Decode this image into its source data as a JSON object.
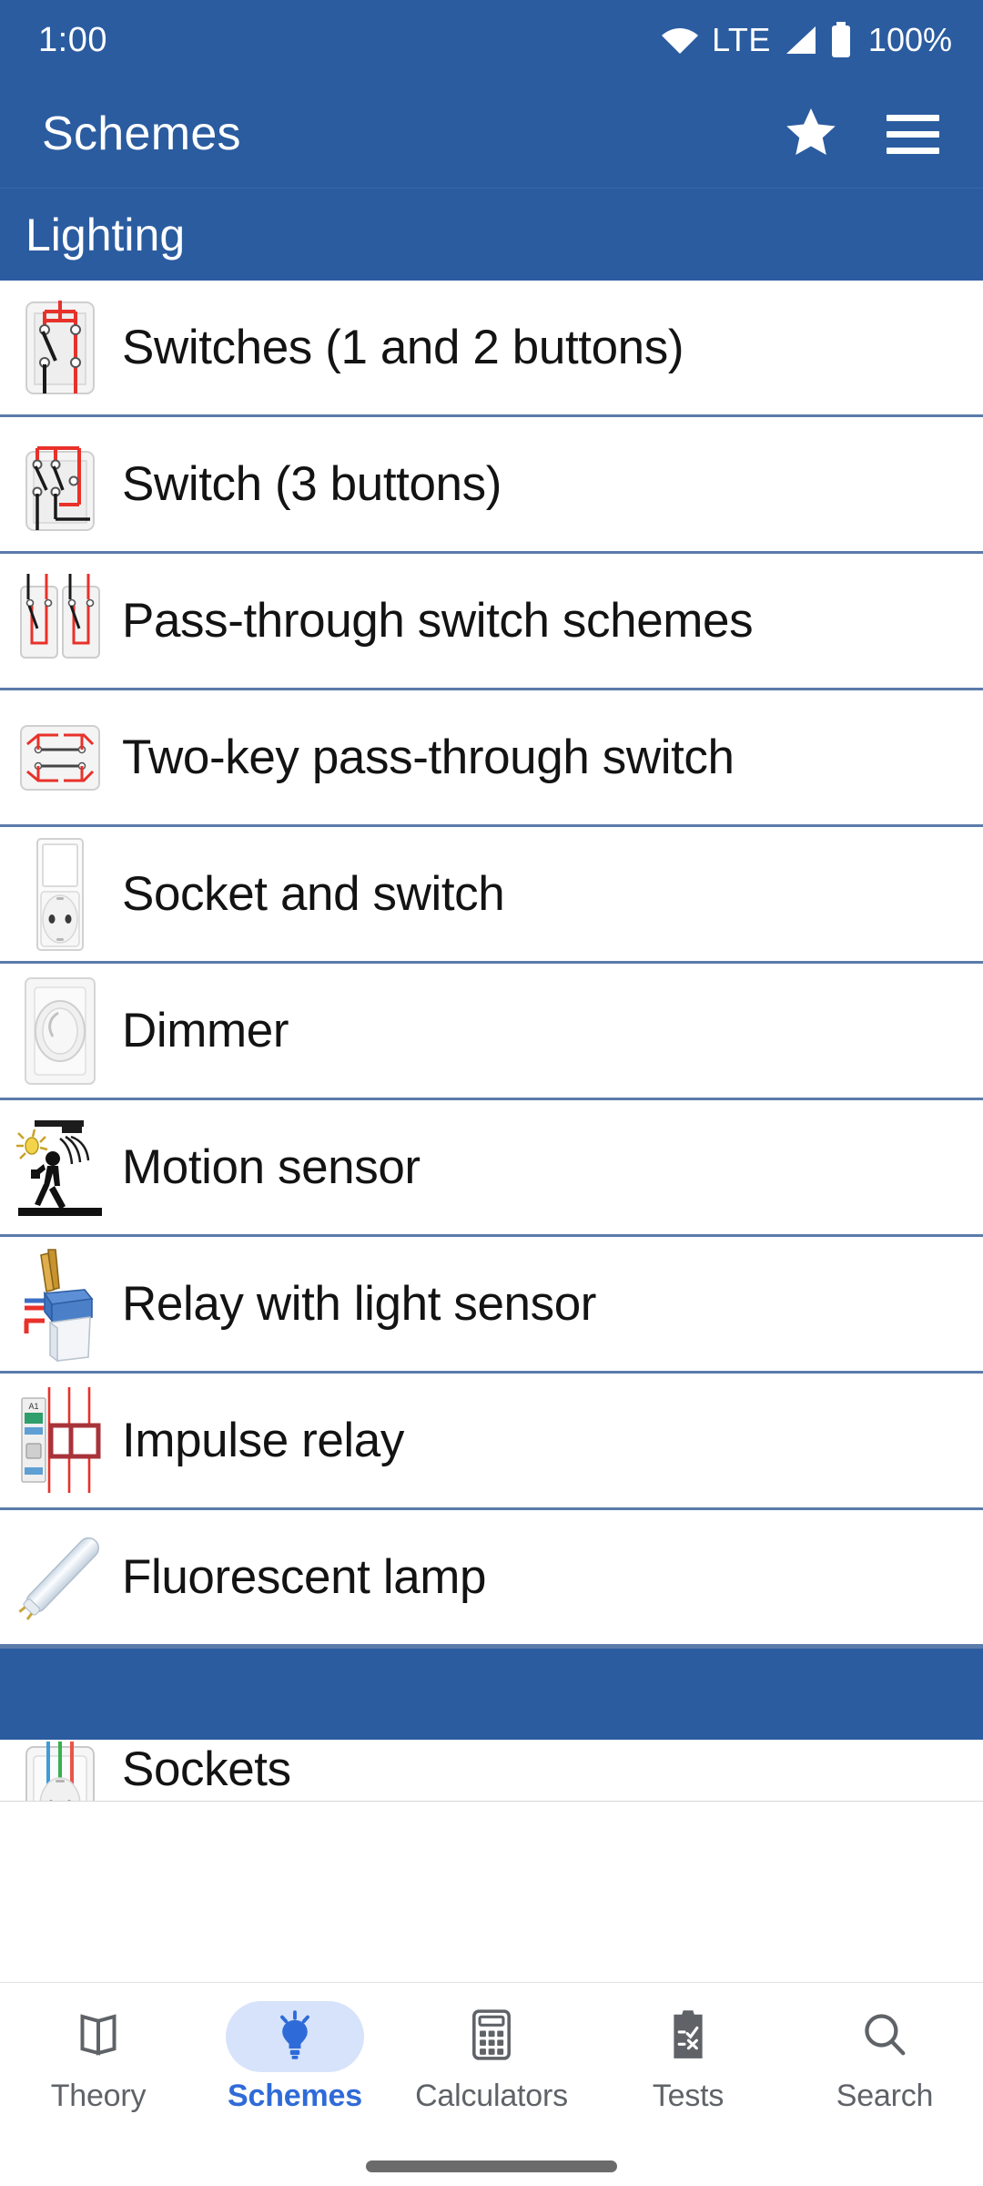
{
  "theme": {
    "primary": "#2B5CA0",
    "divider": "#5B7BAA",
    "accent": "#2F6BD8",
    "accent_pill": "#D7E3FA",
    "nav_inactive": "#5F6368",
    "list_text": "#131313",
    "surface": "#FFFFFF"
  },
  "status_bar": {
    "clock": "1:00",
    "wifi_icon": "wifi-icon",
    "network_label": "LTE",
    "signal_icon": "signal-bars-icon",
    "battery_icon": "battery-full-icon",
    "battery_label": "100%"
  },
  "app_bar": {
    "title": "Schemes",
    "actions": [
      {
        "name": "favorites-star-button",
        "icon": "star-icon"
      },
      {
        "name": "menu-button",
        "icon": "hamburger-menu-icon"
      }
    ]
  },
  "sections": [
    {
      "header": "Lighting",
      "items": [
        {
          "label": "Switches (1 and 2 buttons)",
          "icon": "switch-1-2-buttons-thumb"
        },
        {
          "label": "Switch (3 buttons)",
          "icon": "switch-3-buttons-thumb"
        },
        {
          "label": "Pass-through switch schemes",
          "icon": "pass-through-switch-thumb"
        },
        {
          "label": "Two-key pass-through switch",
          "icon": "two-key-pass-through-thumb"
        },
        {
          "label": "Socket and switch",
          "icon": "socket-and-switch-thumb"
        },
        {
          "label": "Dimmer",
          "icon": "dimmer-thumb"
        },
        {
          "label": "Motion sensor",
          "icon": "motion-sensor-thumb"
        },
        {
          "label": "Relay with light sensor",
          "icon": "relay-light-sensor-thumb"
        },
        {
          "label": "Impulse relay",
          "icon": "impulse-relay-thumb"
        },
        {
          "label": "Fluorescent lamp",
          "icon": "fluorescent-lamp-thumb"
        }
      ]
    },
    {
      "header": "",
      "items": [
        {
          "label": "Sockets",
          "icon": "sockets-thumb"
        }
      ]
    }
  ],
  "bottom_nav": {
    "items": [
      {
        "label": "Theory",
        "icon": "open-book-icon",
        "active": false
      },
      {
        "label": "Schemes",
        "icon": "lightbulb-icon",
        "active": true
      },
      {
        "label": "Calculators",
        "icon": "calculator-icon",
        "active": false
      },
      {
        "label": "Tests",
        "icon": "clipboard-check-icon",
        "active": false
      },
      {
        "label": "Search",
        "icon": "magnifier-icon",
        "active": false
      }
    ]
  }
}
